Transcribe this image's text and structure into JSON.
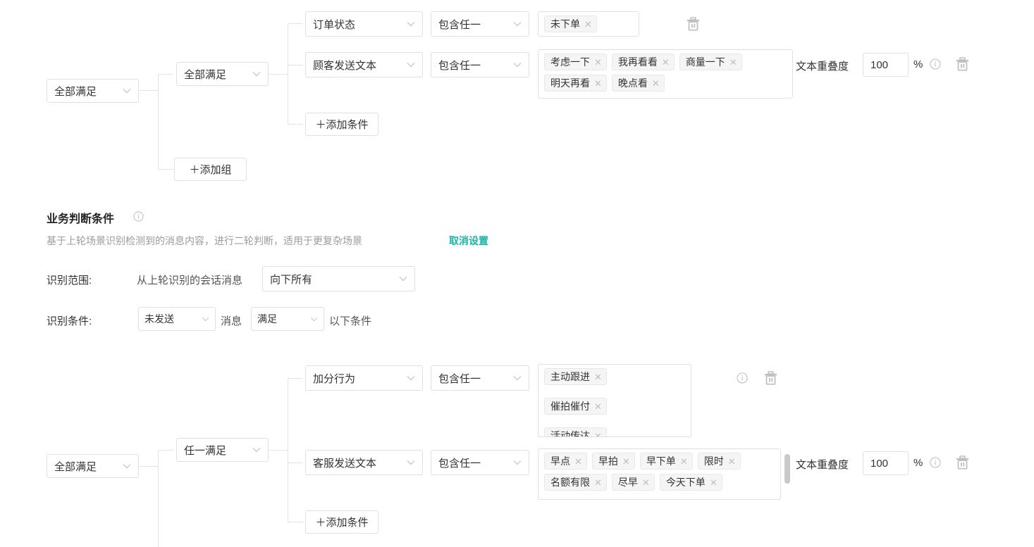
{
  "section_top": {
    "root_select": {
      "value": "全部满足"
    },
    "group_select": {
      "value": "全部满足"
    },
    "add_group_button": "＋添加组",
    "add_condition_button": "＋添加条件",
    "rows": [
      {
        "field_select": "订单状态",
        "operator_select": "包含任一",
        "tags": [
          "未下单"
        ],
        "has_overlap": false
      },
      {
        "field_select": "顾客发送文本",
        "operator_select": "包含任一",
        "tags": [
          "考虑一下",
          "我再看看",
          "商量一下",
          "明天再看",
          "晚点看"
        ],
        "has_overlap": true,
        "overlap_label": "文本重叠度",
        "overlap_value": "100",
        "percent_symbol": "%"
      }
    ]
  },
  "business_section": {
    "title": "业务判断条件",
    "description": "基于上轮场景识别检测到的消息内容，进行二轮判断，适用于更复杂场景",
    "cancel_link": "取消设置",
    "scope_row": {
      "label": "识别范围:",
      "prefix": "从上轮识别的会话消息",
      "select_value": "向下所有"
    },
    "condition_row": {
      "label": "识别条件:",
      "select_sent": "未发送",
      "middle_text": "消息",
      "select_match": "满足",
      "suffix_text": "以下条件"
    }
  },
  "section_bottom": {
    "root_select": {
      "value": "全部满足"
    },
    "group_select": {
      "value": "任一满足"
    },
    "add_condition_button": "＋添加条件",
    "rows": [
      {
        "field_select": "加分行为",
        "operator_select": "包含任一",
        "tags": [
          "主动跟进",
          "催拍催付",
          "活动传达"
        ],
        "has_overlap": false,
        "has_info": true
      },
      {
        "field_select": "客服发送文本",
        "operator_select": "包含任一",
        "tags": [
          "早点",
          "早拍",
          "早下单",
          "限时",
          "名额有限",
          "尽早",
          "今天下单"
        ],
        "has_overlap": true,
        "overlap_label": "文本重叠度",
        "overlap_value": "100",
        "percent_symbol": "%"
      }
    ]
  },
  "icons": {
    "delete": "trash-icon",
    "info": "info-circle-icon",
    "chevron": "chevron-down-icon"
  },
  "colors": {
    "link_teal": "#18b5a7",
    "border": "#e0e0e0",
    "tag_bg": "#f5f5f5",
    "text": "#333333",
    "muted": "#9b9b9b"
  }
}
